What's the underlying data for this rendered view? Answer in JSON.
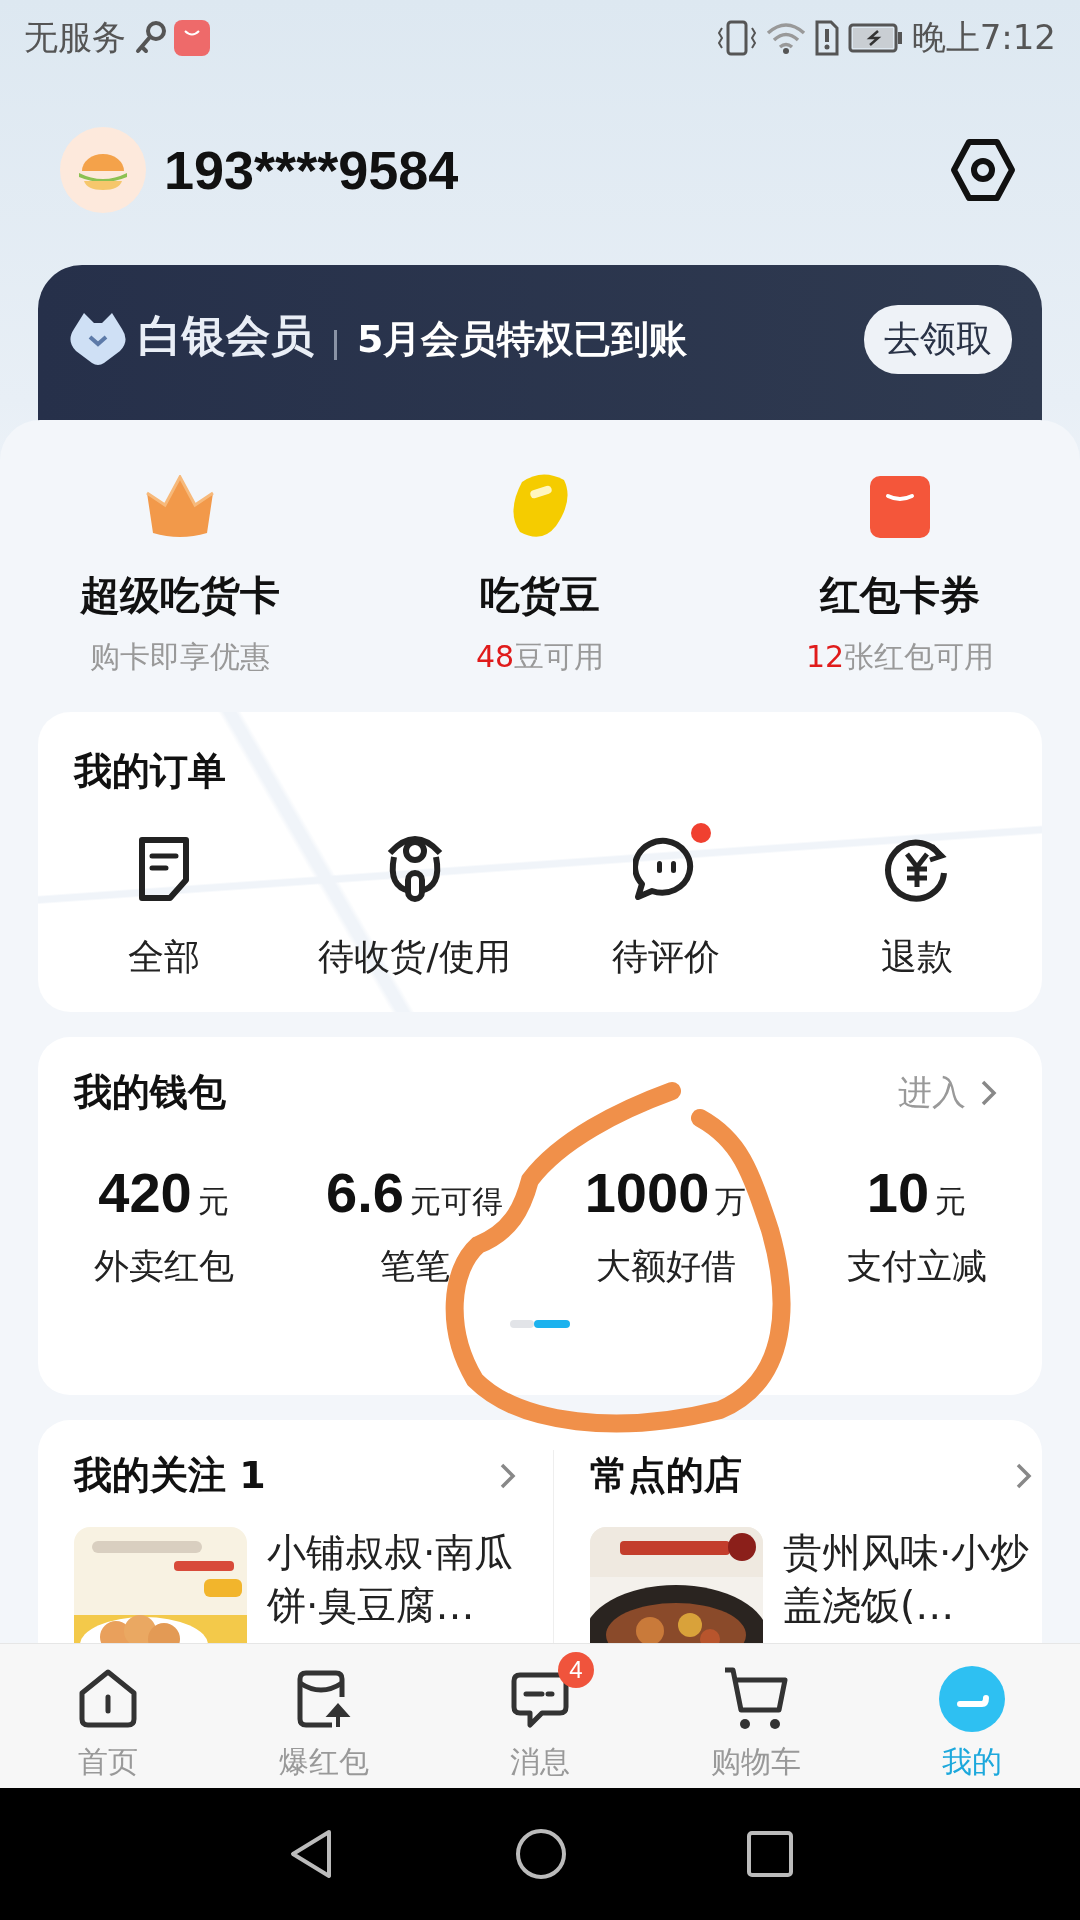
{
  "status_bar": {
    "carrier": "无服务",
    "time": "晚上7:12"
  },
  "profile": {
    "phone": "193****9584"
  },
  "member": {
    "level": "白银会员",
    "message": "5月会员特权已到账",
    "button": "去领取"
  },
  "benefits": [
    {
      "kind": "crown",
      "title": "超级吃货卡",
      "subtitle": "购卡即享优惠"
    },
    {
      "kind": "bean",
      "title": "吃货豆",
      "count": "48",
      "subtitle": "豆可用"
    },
    {
      "kind": "packet",
      "title": "红包卡券",
      "count": "12",
      "subtitle": "张红包可用"
    }
  ],
  "orders": {
    "title": "我的订单",
    "items": [
      {
        "kind": "all",
        "label": "全部",
        "unread": false
      },
      {
        "kind": "delivery",
        "label": "待收货/使用",
        "unread": false
      },
      {
        "kind": "review",
        "label": "待评价",
        "unread": true
      },
      {
        "kind": "refund",
        "label": "退款",
        "unread": false
      }
    ]
  },
  "wallet": {
    "title": "我的钱包",
    "link": "进入",
    "items": [
      {
        "value": "420",
        "unit": "元",
        "label": "外卖红包"
      },
      {
        "value": "6.6",
        "unit": "元可得",
        "label": "笔笔"
      },
      {
        "value": "1000",
        "unit": "万",
        "label": "大额好借"
      },
      {
        "value": "10",
        "unit": "元",
        "label": "支付立减"
      }
    ],
    "pages": [
      {
        "selected": false
      },
      {
        "selected": true
      }
    ]
  },
  "shortcuts": [
    {
      "title": "我的关注 1",
      "name": "小铺叔叔·南瓜饼·臭豆腐…"
    },
    {
      "title": "常点的店",
      "name": "贵州风味·小炒盖浇饭(…"
    }
  ],
  "nav": {
    "items": [
      {
        "kind": "home",
        "label": "首页",
        "selected": false
      },
      {
        "kind": "packet",
        "label": "爆红包",
        "selected": false
      },
      {
        "kind": "message",
        "label": "消息",
        "badge": "4",
        "selected": false
      },
      {
        "kind": "cart",
        "label": "购物车",
        "selected": false
      },
      {
        "kind": "me",
        "label": "我的",
        "selected": true
      }
    ]
  }
}
